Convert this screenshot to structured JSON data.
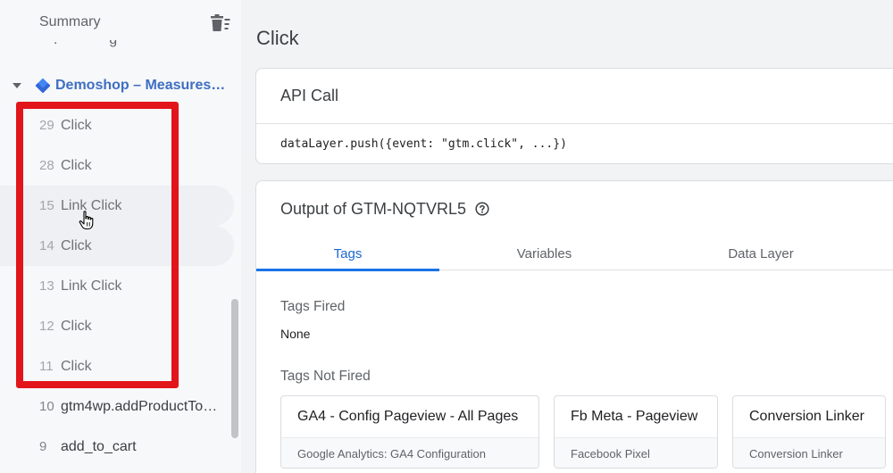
{
  "sidebar": {
    "summary_label": "Summary",
    "container_label": "Demoshop – Measures…",
    "events": [
      {
        "num": "29",
        "label": "Click"
      },
      {
        "num": "28",
        "label": "Click"
      },
      {
        "num": "15",
        "label": "Link Click"
      },
      {
        "num": "14",
        "label": "Click"
      },
      {
        "num": "13",
        "label": "Link Click"
      },
      {
        "num": "12",
        "label": "Click"
      },
      {
        "num": "11",
        "label": "Click"
      },
      {
        "num": "10",
        "label": "gtm4wp.addProductTo…"
      },
      {
        "num": "9",
        "label": "add_to_cart"
      }
    ]
  },
  "main": {
    "title": "Click",
    "api_call": {
      "heading": "API Call",
      "code": "dataLayer.push({event: \"gtm.click\", ...})"
    },
    "output": {
      "heading": "Output of GTM-NQTVRL5",
      "tabs": [
        {
          "label": "Tags"
        },
        {
          "label": "Variables"
        },
        {
          "label": "Data Layer"
        }
      ],
      "tags_fired_title": "Tags Fired",
      "tags_fired_value": "None",
      "tags_not_fired_title": "Tags Not Fired",
      "tags_not_fired": [
        {
          "name": "GA4 - Config Pageview - All Pages",
          "type": "Google Analytics: GA4 Configuration"
        },
        {
          "name": "Fb Meta - Pageview",
          "type": "Facebook Pixel"
        },
        {
          "name": "Conversion Linker",
          "type": "Conversion Linker"
        }
      ]
    }
  },
  "colors": {
    "accent": "#1a73e8",
    "highlight": "#e2151a",
    "container_link": "#3e6fc2"
  }
}
